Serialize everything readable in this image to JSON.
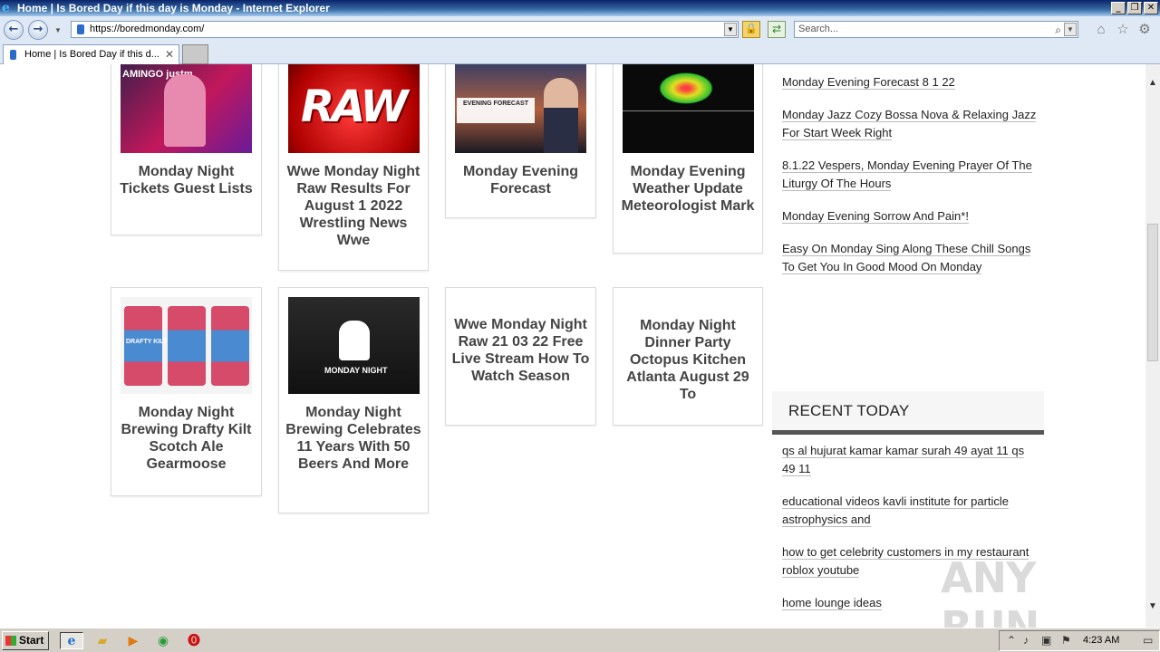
{
  "window": {
    "title": "Home | Is Bored Day if this day is Monday - Internet Explorer",
    "minimize": "_",
    "restore": "❐",
    "close": "✕"
  },
  "navbar": {
    "back_icon": "back-arrow-icon",
    "forward_icon": "forward-arrow-icon",
    "url": "https://boredmonday.com/",
    "search_placeholder": "Search..."
  },
  "tabs": [
    {
      "label": "Home | Is Bored Day if this d...",
      "active": true
    }
  ],
  "cards": [
    {
      "title": "Monday Night Tickets Guest Lists",
      "thumb_text": "AMINGO  justm"
    },
    {
      "title": "Wwe Monday Night Raw Results For August 1 2022 Wrestling News Wwe",
      "thumb_text": "RAW"
    },
    {
      "title": "Monday Evening Forecast",
      "thumb_text": "EVENING FORECAST"
    },
    {
      "title": "Monday Evening Weather Update Meteorologist Mark",
      "thumb_text": ""
    },
    {
      "title": "Monday Night Brewing Drafty Kilt Scotch Ale Gearmoose",
      "thumb_text": "DRAFTY KILT"
    },
    {
      "title": "Monday Night Brewing Celebrates 11 Years With 50 Beers And More",
      "thumb_text": "MONDAY NIGHT"
    },
    {
      "title": "Wwe Monday Night Raw 21 03 22 Free Live Stream How To Watch Season",
      "thumb_text": ""
    },
    {
      "title": "Monday Night Dinner Party Octopus Kitchen Atlanta August 29 To",
      "thumb_text": ""
    }
  ],
  "sidebar": {
    "top_links": [
      "Monday Evening Forecast 8 1 22",
      "Monday Jazz Cozy Bossa Nova & Relaxing Jazz For Start Week Right",
      "8.1.22 Vespers, Monday Evening Prayer Of The Liturgy Of The Hours",
      "Monday Evening Sorrow And Pain*!",
      "Easy On Monday Sing Along These Chill Songs To Get You In Good Mood On Monday"
    ],
    "recent_heading": "RECENT TODAY",
    "recent_links": [
      "qs al hujurat kamar kamar surah 49 ayat 11 qs 49 11",
      "educational videos kavli institute for particle astrophysics and",
      "how to get celebrity customers in my restaurant roblox youtube",
      "home lounge ideas"
    ]
  },
  "watermark": "ANY RUN",
  "taskbar": {
    "start_label": "Start",
    "clock": "4:23 AM"
  }
}
